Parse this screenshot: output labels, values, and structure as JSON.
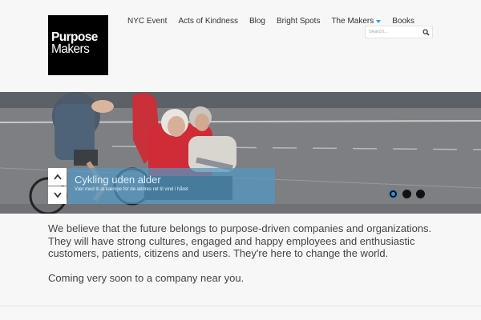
{
  "logo": {
    "line1": "Purpose",
    "line2": "Makers"
  },
  "nav": {
    "items": [
      {
        "label": "NYC Event"
      },
      {
        "label": "Acts of Kindness"
      },
      {
        "label": "Blog"
      },
      {
        "label": "Bright Spots"
      },
      {
        "label": "The Makers",
        "has_dropdown": true
      },
      {
        "label": "Books"
      }
    ]
  },
  "search": {
    "placeholder": "Search...",
    "icon": "search-icon"
  },
  "slider": {
    "caption_title": "Cykling uden alder",
    "caption_subtitle": "Vær med til at kæmpe for de ældres ret til vind i håret",
    "up_icon": "chevron-up-icon",
    "down_icon": "chevron-down-icon",
    "dots": [
      {
        "active": true
      },
      {
        "active": false
      },
      {
        "active": false
      }
    ]
  },
  "content": {
    "paragraph1": "We believe that the future belongs to purpose-driven companies and organizations. They will have strong cultures, engaged and happy employees and enthusiastic customers, patients, citizens and users. They're here to change the world.",
    "paragraph2": "Coming very soon to a company near you."
  },
  "colors": {
    "accent": "#2a9fd6",
    "caption_bg": "#5298c4",
    "text": "#444444",
    "background": "#f7f7f7"
  }
}
